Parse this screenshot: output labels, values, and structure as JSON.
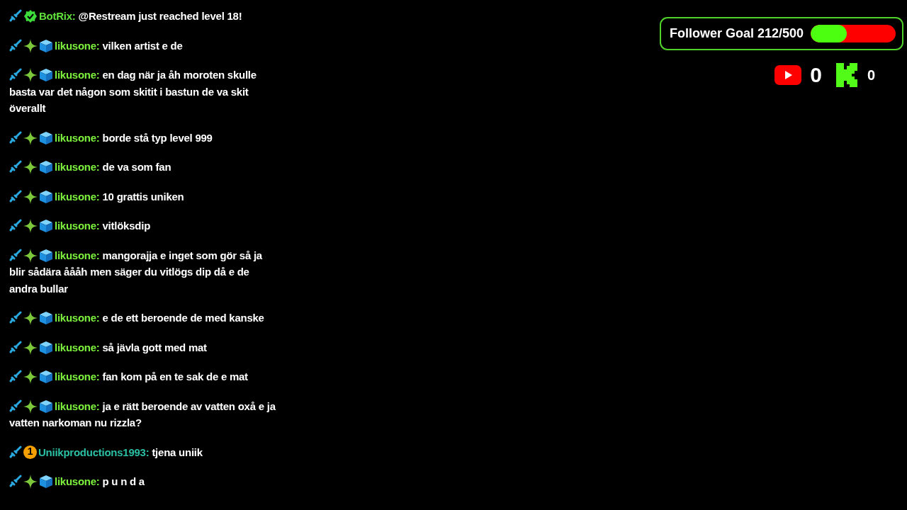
{
  "chat": [
    {
      "badges": [
        {
          "kind": "sword"
        },
        {
          "kind": "verified"
        }
      ],
      "user": "BotRix:",
      "color": "#5fe03a",
      "text": "@Restream just reached level 18!"
    },
    {
      "badges": [
        {
          "kind": "sword"
        },
        {
          "kind": "sparkle"
        },
        {
          "kind": "cube"
        }
      ],
      "user": "likusone:",
      "color": "#7cf03c",
      "text": "vilken artist e de"
    },
    {
      "badges": [
        {
          "kind": "sword"
        },
        {
          "kind": "sparkle"
        },
        {
          "kind": "cube"
        }
      ],
      "user": "likusone:",
      "color": "#7cf03c",
      "text": "en dag när ja åh moroten skulle",
      "more": [
        "basta var det någon som skitit i bastun de va skit",
        "överallt"
      ]
    },
    {
      "badges": [
        {
          "kind": "sword"
        },
        {
          "kind": "sparkle"
        },
        {
          "kind": "cube"
        }
      ],
      "user": "likusone:",
      "color": "#7cf03c",
      "text": "borde stå typ level 999"
    },
    {
      "badges": [
        {
          "kind": "sword"
        },
        {
          "kind": "sparkle"
        },
        {
          "kind": "cube"
        }
      ],
      "user": "likusone:",
      "color": "#7cf03c",
      "text": "de va som fan"
    },
    {
      "badges": [
        {
          "kind": "sword"
        },
        {
          "kind": "sparkle"
        },
        {
          "kind": "cube"
        }
      ],
      "user": "likusone:",
      "color": "#7cf03c",
      "text": "10 grattis uniken"
    },
    {
      "badges": [
        {
          "kind": "sword"
        },
        {
          "kind": "sparkle"
        },
        {
          "kind": "cube"
        }
      ],
      "user": "likusone:",
      "color": "#7cf03c",
      "text": "vitlöksdip"
    },
    {
      "badges": [
        {
          "kind": "sword"
        },
        {
          "kind": "sparkle"
        },
        {
          "kind": "cube"
        }
      ],
      "user": "likusone:",
      "color": "#7cf03c",
      "text": "mangorajja e inget som gör så ja",
      "more": [
        "blir sådära åååh men säger du vitlögs dip då e de",
        "andra bullar"
      ]
    },
    {
      "badges": [
        {
          "kind": "sword"
        },
        {
          "kind": "sparkle"
        },
        {
          "kind": "cube"
        }
      ],
      "user": "likusone:",
      "color": "#7cf03c",
      "text": "e de ett beroende de med kanske"
    },
    {
      "badges": [
        {
          "kind": "sword"
        },
        {
          "kind": "sparkle"
        },
        {
          "kind": "cube"
        }
      ],
      "user": "likusone:",
      "color": "#7cf03c",
      "text": "så jävla gott med mat"
    },
    {
      "badges": [
        {
          "kind": "sword"
        },
        {
          "kind": "sparkle"
        },
        {
          "kind": "cube"
        }
      ],
      "user": "likusone:",
      "color": "#7cf03c",
      "text": "fan kom på en te sak de e mat"
    },
    {
      "badges": [
        {
          "kind": "sword"
        },
        {
          "kind": "sparkle"
        },
        {
          "kind": "cube"
        }
      ],
      "user": "likusone:",
      "color": "#7cf03c",
      "text": "ja e rätt beroende av vatten oxå e ja",
      "more": [
        "vatten narkoman nu rizzla?"
      ]
    },
    {
      "badges": [
        {
          "kind": "sword"
        },
        {
          "kind": "number",
          "text": "1"
        }
      ],
      "user": "Uniikproductions1993:",
      "color": "#2bbfa4",
      "text": "tjena uniik"
    },
    {
      "badges": [
        {
          "kind": "sword"
        },
        {
          "kind": "sparkle"
        },
        {
          "kind": "cube"
        }
      ],
      "user": "likusone:",
      "color": "#7cf03c",
      "text": "p u n d a"
    }
  ],
  "follower_goal": {
    "label": "Follower Goal 212/500",
    "level": 0.424
  },
  "counters": [
    {
      "kind": "youtube",
      "count": "0"
    },
    {
      "kind": "kick",
      "count": "0"
    }
  ]
}
